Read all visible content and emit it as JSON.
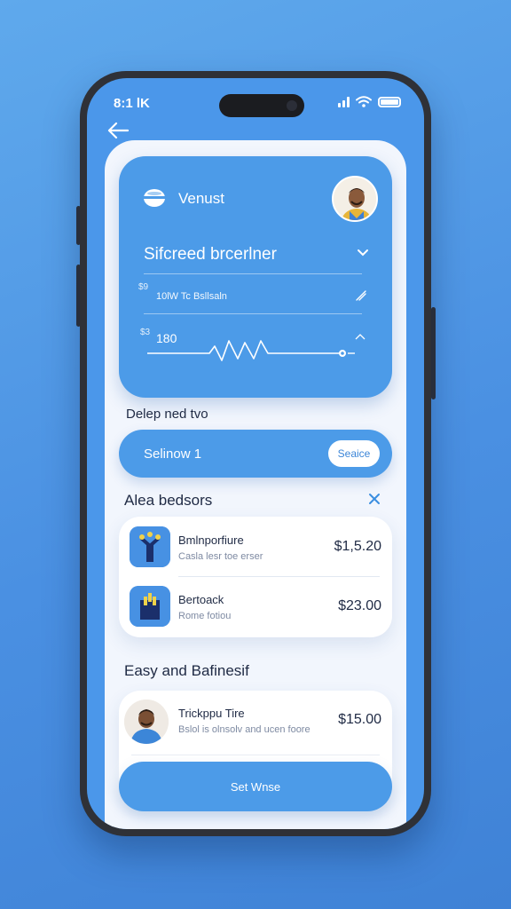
{
  "status": {
    "time": "8:1 lK"
  },
  "hero": {
    "brand": "Venust",
    "title": "Sifcreed brcerlner",
    "row1_tag": "$9",
    "row1_text": "10lW Tc Bsllsaln",
    "row2_tag": "$3",
    "row2_value": "180"
  },
  "section1": {
    "title": "Delep ned tvo"
  },
  "select": {
    "label": "Selinow 1",
    "button": "Seaice"
  },
  "section2": {
    "title": "Alea bedsors",
    "items": [
      {
        "name": "Bmlnporfiure",
        "sub": "Casla lesr toe erser",
        "price": "$1,5.20"
      },
      {
        "name": "Bertoack",
        "sub": "Rome fotiou",
        "price": "$23.00"
      }
    ]
  },
  "section3": {
    "title": "Easy and Bafinesif",
    "items": [
      {
        "name": "Trickppu Tire",
        "sub": "Bslol is olnsolv and ucen foore",
        "price": "$15.00"
      }
    ]
  },
  "cta": {
    "label": "Set Wnse"
  },
  "colors": {
    "accent": "#4c9be8",
    "background": "#4a90e2",
    "sheet": "#f2f6fd",
    "text_dark": "#1f2a44"
  }
}
